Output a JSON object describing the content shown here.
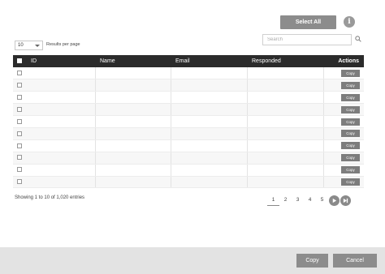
{
  "toolbar": {
    "select_all_label": "Select All",
    "info_glyph": "i"
  },
  "controls": {
    "per_page_value": "10",
    "per_page_label": "Results per page",
    "search_placeholder": "Search"
  },
  "table": {
    "columns": [
      "",
      "ID",
      "Name",
      "Email",
      "Responded",
      "Actions"
    ],
    "row_action_label": "Copy",
    "rows": [
      {
        "id": "",
        "name": "",
        "email": "",
        "responded": ""
      },
      {
        "id": "",
        "name": "",
        "email": "",
        "responded": ""
      },
      {
        "id": "",
        "name": "",
        "email": "",
        "responded": ""
      },
      {
        "id": "",
        "name": "",
        "email": "",
        "responded": ""
      },
      {
        "id": "",
        "name": "",
        "email": "",
        "responded": ""
      },
      {
        "id": "",
        "name": "",
        "email": "",
        "responded": ""
      },
      {
        "id": "",
        "name": "",
        "email": "",
        "responded": ""
      },
      {
        "id": "",
        "name": "",
        "email": "",
        "responded": ""
      },
      {
        "id": "",
        "name": "",
        "email": "",
        "responded": ""
      },
      {
        "id": "",
        "name": "",
        "email": "",
        "responded": ""
      }
    ]
  },
  "footer_info": {
    "entries_text": "Showing 1 to 10 of 1,020 entries"
  },
  "pagination": {
    "pages": [
      "1",
      "2",
      "3",
      "4",
      "5"
    ],
    "active_page": "1",
    "next_icon": "next-page-icon",
    "last_icon": "last-page-icon"
  },
  "dialog_footer": {
    "copy_label": "Copy",
    "cancel_label": "Cancel"
  },
  "colors": {
    "header_bg": "#2b2b2b",
    "button_gray": "#8c8c8c",
    "footer_bg": "#e3e3e3"
  }
}
